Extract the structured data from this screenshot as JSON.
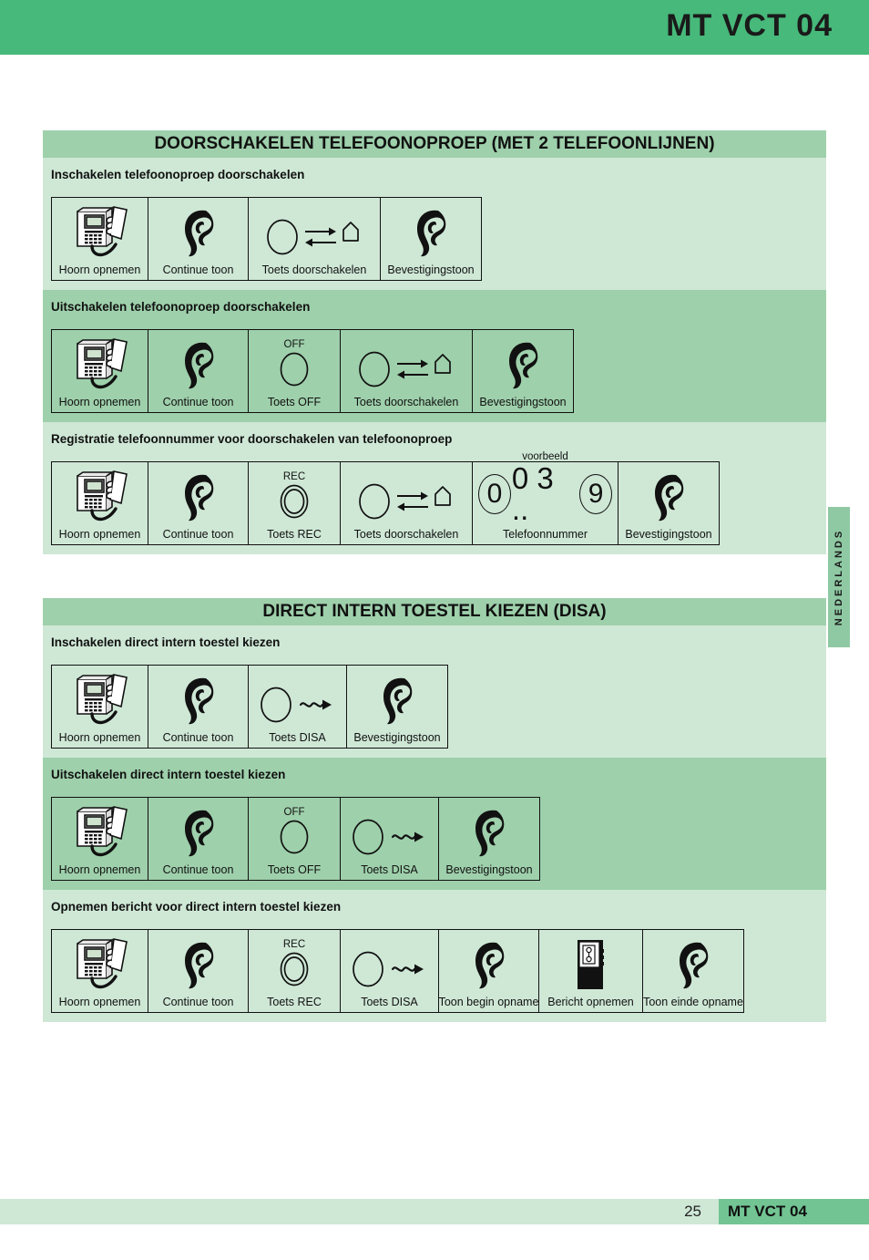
{
  "header": {
    "title": "MT VCT 04"
  },
  "side_tab": {
    "label": "NEDERLANDS"
  },
  "footer": {
    "page_number": "25",
    "model": "MT VCT 04"
  },
  "colors": {
    "header_green": "#47b97a",
    "band_green": "#9ed0ab",
    "panel_light": "#cfe8d6",
    "tab_green": "#8fc9a3",
    "footer_dark": "#72c493",
    "ink": "#111111"
  },
  "sections": [
    {
      "title": "DOORSCHAKELEN TELEFOONOPROEP  (MET 2 TELEFOONLIJNEN)",
      "blocks": [
        {
          "heading": "Inschakelen telefoonoproep doorschakelen",
          "shade": "light",
          "steps": [
            {
              "icon": "phone-handset-pickup-icon",
              "cap": "",
              "label": "Hoorn opnemen"
            },
            {
              "icon": "ear-icon",
              "cap": "",
              "label": "Continue toon"
            },
            {
              "icon": "forward-key-icon",
              "cap": "",
              "label": "Toets doorschakelen"
            },
            {
              "icon": "ear-icon",
              "cap": "",
              "label": "Bevestigingstoon"
            }
          ]
        },
        {
          "heading": "Uitschakelen telefoonoproep doorschakelen",
          "shade": "mid",
          "steps": [
            {
              "icon": "phone-handset-pickup-icon",
              "cap": "",
              "label": "Hoorn opnemen"
            },
            {
              "icon": "ear-icon",
              "cap": "",
              "label": "Continue toon"
            },
            {
              "icon": "button-icon",
              "cap": "OFF",
              "label": "Toets OFF"
            },
            {
              "icon": "forward-key-icon",
              "cap": "",
              "label": "Toets doorschakelen"
            },
            {
              "icon": "ear-icon",
              "cap": "",
              "label": "Bevestigingstoon"
            }
          ]
        },
        {
          "heading": "Registratie telefoonnummer voor doorschakelen van telefoonoproep",
          "shade": "light",
          "steps": [
            {
              "icon": "phone-handset-pickup-icon",
              "cap": "",
              "label": "Hoorn opnemen"
            },
            {
              "icon": "ear-icon",
              "cap": "",
              "label": "Continue toon"
            },
            {
              "icon": "button-rec-icon",
              "cap": "REC",
              "label": "Toets REC"
            },
            {
              "icon": "forward-key-icon",
              "cap": "",
              "label": "Toets doorschakelen"
            },
            {
              "icon": "phone-number-icon",
              "cap": "voorbeeld",
              "label": "Telefoonnummer",
              "number": {
                "first": "0",
                "middle": "0 3 ..",
                "last": "9"
              }
            },
            {
              "icon": "ear-icon",
              "cap": "",
              "label": "Bevestigingstoon"
            }
          ]
        }
      ]
    },
    {
      "title": "DIRECT INTERN TOESTEL KIEZEN (DISA)",
      "blocks": [
        {
          "heading": "Inschakelen direct intern toestel kiezen",
          "shade": "light",
          "steps": [
            {
              "icon": "phone-handset-pickup-icon",
              "cap": "",
              "label": "Hoorn opnemen"
            },
            {
              "icon": "ear-icon",
              "cap": "",
              "label": "Continue toon"
            },
            {
              "icon": "disa-key-icon",
              "cap": "",
              "label": "Toets DISA"
            },
            {
              "icon": "ear-icon",
              "cap": "",
              "label": "Bevestigingstoon"
            }
          ]
        },
        {
          "heading": "Uitschakelen direct intern toestel kiezen",
          "shade": "mid",
          "steps": [
            {
              "icon": "phone-handset-pickup-icon",
              "cap": "",
              "label": "Hoorn opnemen"
            },
            {
              "icon": "ear-icon",
              "cap": "",
              "label": "Continue toon"
            },
            {
              "icon": "button-icon",
              "cap": "OFF",
              "label": "Toets OFF"
            },
            {
              "icon": "disa-key-icon",
              "cap": "",
              "label": "Toets DISA"
            },
            {
              "icon": "ear-icon",
              "cap": "",
              "label": "Bevestigingstoon"
            }
          ]
        },
        {
          "heading": "Opnemen bericht voor direct intern toestel kiezen",
          "shade": "light",
          "steps": [
            {
              "icon": "phone-handset-pickup-icon",
              "cap": "",
              "label": "Hoorn opnemen"
            },
            {
              "icon": "ear-icon",
              "cap": "",
              "label": "Continue toon"
            },
            {
              "icon": "button-rec-icon",
              "cap": "REC",
              "label": "Toets REC"
            },
            {
              "icon": "disa-key-icon",
              "cap": "",
              "label": "Toets DISA"
            },
            {
              "icon": "ear-icon",
              "cap": "",
              "label": "Toon begin opname"
            },
            {
              "icon": "cassette-recorder-icon",
              "cap": "",
              "label": "Bericht opnemen"
            },
            {
              "icon": "ear-icon",
              "cap": "",
              "label": "Toon einde opname"
            }
          ]
        }
      ]
    }
  ]
}
